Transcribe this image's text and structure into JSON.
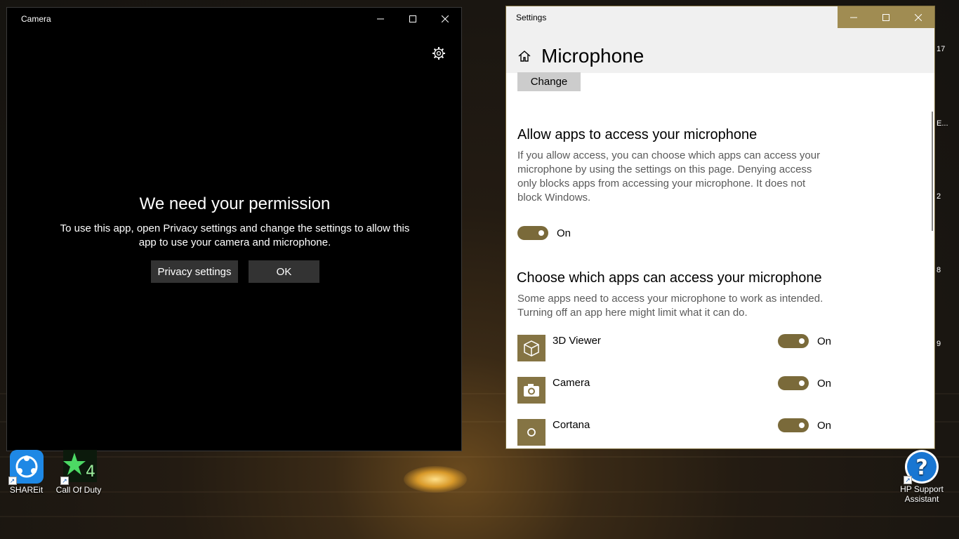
{
  "camera": {
    "title": "Camera",
    "permission_title": "We need your permission",
    "permission_text_line1": "To use this app, open Privacy settings and change the settings to allow this",
    "permission_text_line2": "app to use your camera and microphone.",
    "privacy_button": "Privacy settings",
    "ok_button": "OK"
  },
  "settings": {
    "window_title": "Settings",
    "page_title": "Microphone",
    "change_button": "Change",
    "allow_heading": "Allow apps to access your microphone",
    "allow_desc": [
      "If you allow access, you can choose which apps can access your",
      "microphone by using the settings on this page. Denying access",
      "only blocks apps from accessing your microphone. It does not",
      "block Windows."
    ],
    "allow_toggle_label": "On",
    "choose_heading": "Choose which apps can access your microphone",
    "choose_desc": [
      "Some apps need to access your microphone to work as intended.",
      "Turning off an app here might limit what it can do."
    ],
    "apps": [
      {
        "name": "3D Viewer",
        "state": "On",
        "icon": "cube-icon"
      },
      {
        "name": "Camera",
        "state": "On",
        "icon": "camera-icon"
      },
      {
        "name": "Cortana",
        "state": "On",
        "icon": "cortana-circle-icon"
      }
    ],
    "accent_color": "#7a6a3a"
  },
  "desktop": {
    "icons": [
      {
        "label": "SHAREit",
        "icon": "shareit-icon"
      },
      {
        "label": "Call Of Duty",
        "icon": "call-of-duty-icon"
      },
      {
        "label_line1": "HP Support",
        "label_line2": "Assistant",
        "icon": "help-icon"
      }
    ],
    "edge_labels": [
      "17",
      "E...",
      "2",
      "8",
      "9"
    ]
  }
}
